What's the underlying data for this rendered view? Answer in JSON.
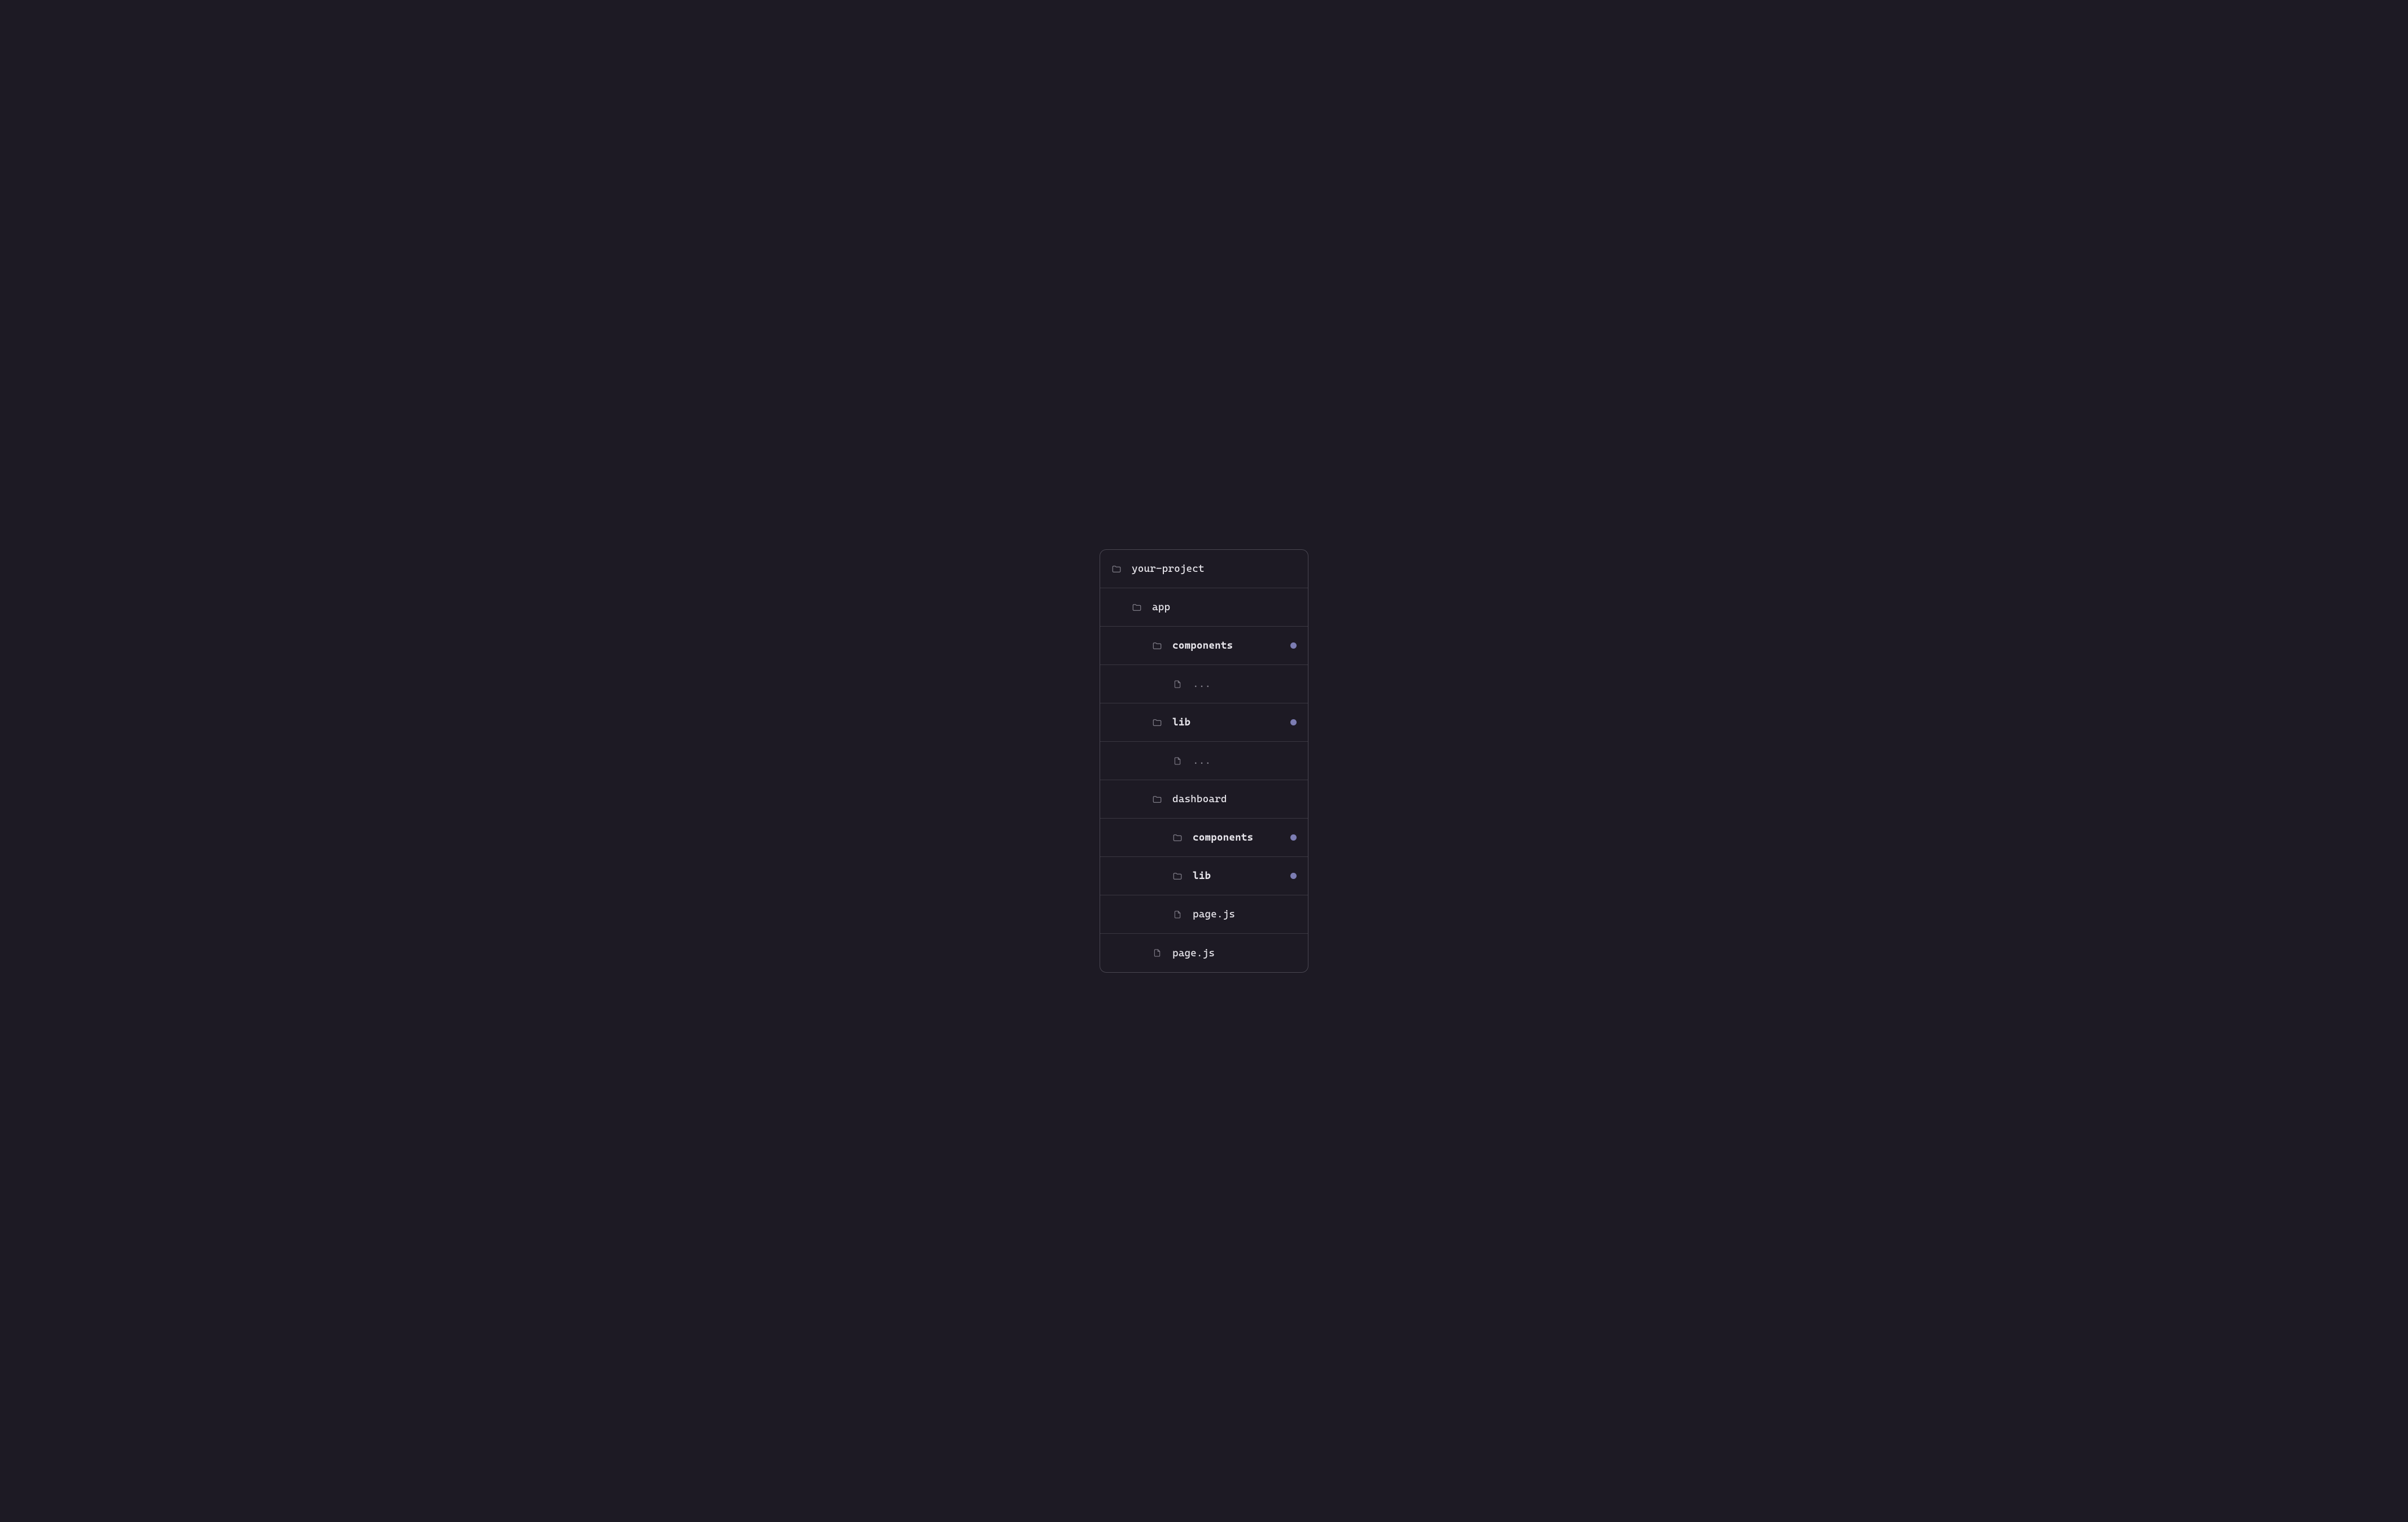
{
  "tree": {
    "rows": [
      {
        "label": "your-project",
        "icon": "folder",
        "indent": 0,
        "bold": false,
        "dim": false,
        "dot": false
      },
      {
        "label": "app",
        "icon": "folder",
        "indent": 1,
        "bold": false,
        "dim": false,
        "dot": false
      },
      {
        "label": "components",
        "icon": "folder",
        "indent": 2,
        "bold": true,
        "dim": false,
        "dot": true
      },
      {
        "label": "...",
        "icon": "file",
        "indent": 3,
        "bold": false,
        "dim": true,
        "dot": false
      },
      {
        "label": "lib",
        "icon": "folder",
        "indent": 2,
        "bold": true,
        "dim": false,
        "dot": true
      },
      {
        "label": "...",
        "icon": "file",
        "indent": 3,
        "bold": false,
        "dim": true,
        "dot": false
      },
      {
        "label": "dashboard",
        "icon": "folder",
        "indent": 2,
        "bold": false,
        "dim": false,
        "dot": false
      },
      {
        "label": "components",
        "icon": "folder",
        "indent": 3,
        "bold": true,
        "dim": false,
        "dot": true
      },
      {
        "label": "lib",
        "icon": "folder",
        "indent": 3,
        "bold": true,
        "dim": false,
        "dot": true
      },
      {
        "label": "page.js",
        "icon": "file",
        "indent": 3,
        "bold": false,
        "dim": false,
        "dot": false
      },
      {
        "label": "page.js",
        "icon": "file",
        "indent": 2,
        "bold": false,
        "dim": false,
        "dot": false
      }
    ]
  },
  "colors": {
    "background": "#1d1a24",
    "border": "#4a4752",
    "row_border": "#3a3741",
    "text": "#e8e6ec",
    "text_dim": "#8a8792",
    "dot": "#7c7db3"
  }
}
